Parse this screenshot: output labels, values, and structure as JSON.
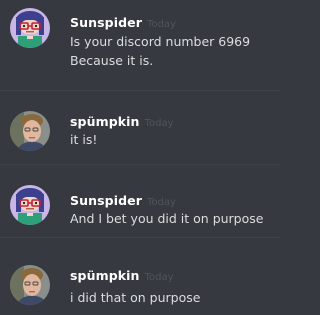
{
  "messages": [
    {
      "author": "Sunspider",
      "timestamp": "Today",
      "avatar": "sunspider-avatar",
      "lines": [
        "Is your discord number 6969",
        "Because it is."
      ]
    },
    {
      "author": "spümpkin",
      "timestamp": "Today",
      "avatar": "spumpkin-avatar",
      "lines": [
        "it is!"
      ]
    },
    {
      "author": "Sunspider",
      "timestamp": "Today",
      "avatar": "sunspider-avatar",
      "lines": [
        "And I bet you did it on purpose"
      ]
    },
    {
      "author": "spümpkin",
      "timestamp": "Today",
      "avatar": "spumpkin-avatar",
      "lines": [
        "i did that on purpose"
      ]
    }
  ],
  "colors": {
    "background": "#36393f",
    "author": "#ffffff",
    "message_text": "#dcddde",
    "timestamp": "#4f545c",
    "divider": "#3f4247"
  }
}
